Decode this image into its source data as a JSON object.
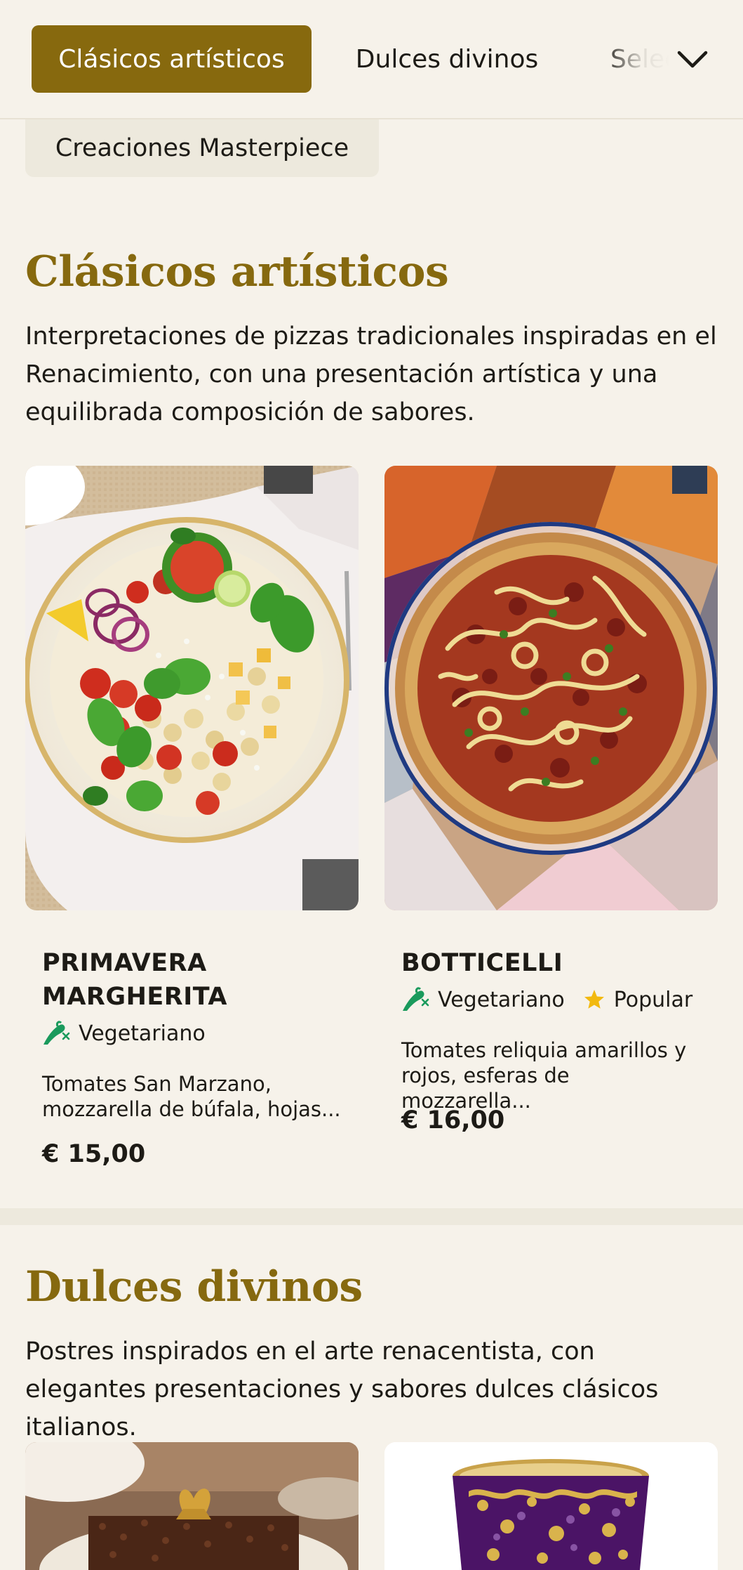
{
  "category_nav": {
    "tabs": [
      {
        "label": "Clásicos artísticos",
        "active": true
      },
      {
        "label": "Dulces divinos",
        "active": false
      },
      {
        "label": "Selecciones",
        "active": false
      },
      {
        "label": "Creaciones Masterpiece",
        "active": false
      }
    ],
    "overflow_icon": "chevron-down-icon"
  },
  "sections": [
    {
      "title": "Clásicos artísticos",
      "description": "Interpretaciones de pizzas tradicionales inspiradas en el Renacimiento, con una presentación artística y una equilibrada composición de sabores.",
      "items": [
        {
          "name": "PRIMAVERA MARGHERITA",
          "tags": [
            {
              "icon": "vegetarian-icon",
              "label": "Vegetariano"
            }
          ],
          "description": "Tomates San Marzano, mozzarella de búfala, hojas...",
          "price": "€ 15,00",
          "image": "salad-plate-photo"
        },
        {
          "name": "BOTTICELLI",
          "tags": [
            {
              "icon": "vegetarian-icon",
              "label": "Vegetariano"
            },
            {
              "icon": "star-icon",
              "label": "Popular"
            }
          ],
          "description": "Tomates reliquia amarillos y rojos, esferas de mozzarella...",
          "price": "€ 16,00",
          "image": "pizza-photo"
        }
      ]
    },
    {
      "title": "Dulces divinos",
      "description": "Postres inspirados en el arte renacentista, con elegantes presentaciones y sabores dulces clásicos italianos.",
      "items": [
        {
          "image": "chocolate-cake-photo"
        },
        {
          "image": "decorated-dessert-cup-photo"
        }
      ]
    }
  ],
  "colors": {
    "accent": "#87690e",
    "background": "#f6f2ea",
    "vegetarian_green": "#1a9a5c",
    "star_yellow": "#f2b90f"
  }
}
